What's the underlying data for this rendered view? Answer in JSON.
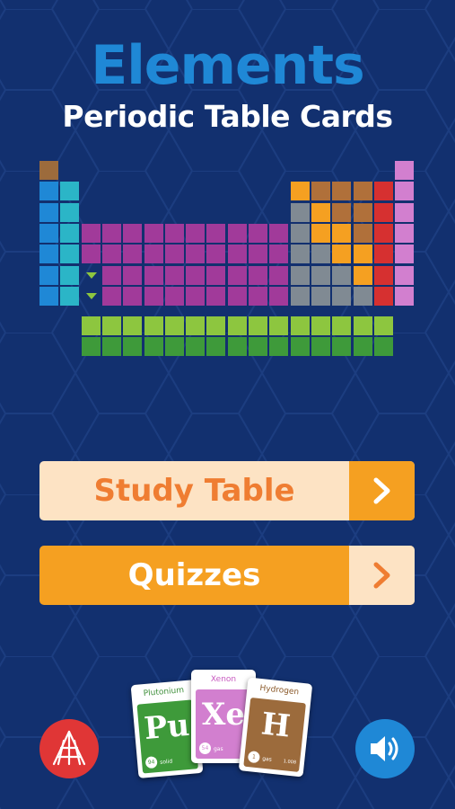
{
  "app": {
    "title": "Elements",
    "subtitle": "Periodic Table Cards"
  },
  "menu": {
    "study_label": "Study Table",
    "quiz_label": "Quizzes"
  },
  "cards": [
    {
      "name": "Plutonium",
      "symbol": "Pu",
      "number": "94",
      "state": "solid",
      "extra": ""
    },
    {
      "name": "Xenon",
      "symbol": "Xe",
      "number": "54",
      "state": "gas",
      "extra": ""
    },
    {
      "name": "Hydrogen",
      "symbol": "H",
      "number": "1",
      "state": "gas",
      "extra": "1.008"
    }
  ],
  "icons": {
    "logo": "publisher-logo-icon",
    "sound": "speaker-icon",
    "arrow": "chevron-right-icon"
  },
  "colors": {
    "background": "#12306f",
    "title": "#1f88d6",
    "orange": "#f5a021",
    "peach": "#fde3c4",
    "logo_red": "#e03636",
    "sound_blue": "#1f88d6",
    "hydrogen": "#9c6b3c",
    "alkali": "#1f88d6",
    "alkaline_earth": "#2bb5c7",
    "transition": "#a13a9a",
    "post_transition": "#808a93",
    "metalloid": "#f5a021",
    "nonmetal": "#b0703a",
    "halogen": "#d63030",
    "noble_gas": "#d27fcf",
    "lanthanide": "#8dc63f",
    "actinide": "#3e9a3a"
  }
}
